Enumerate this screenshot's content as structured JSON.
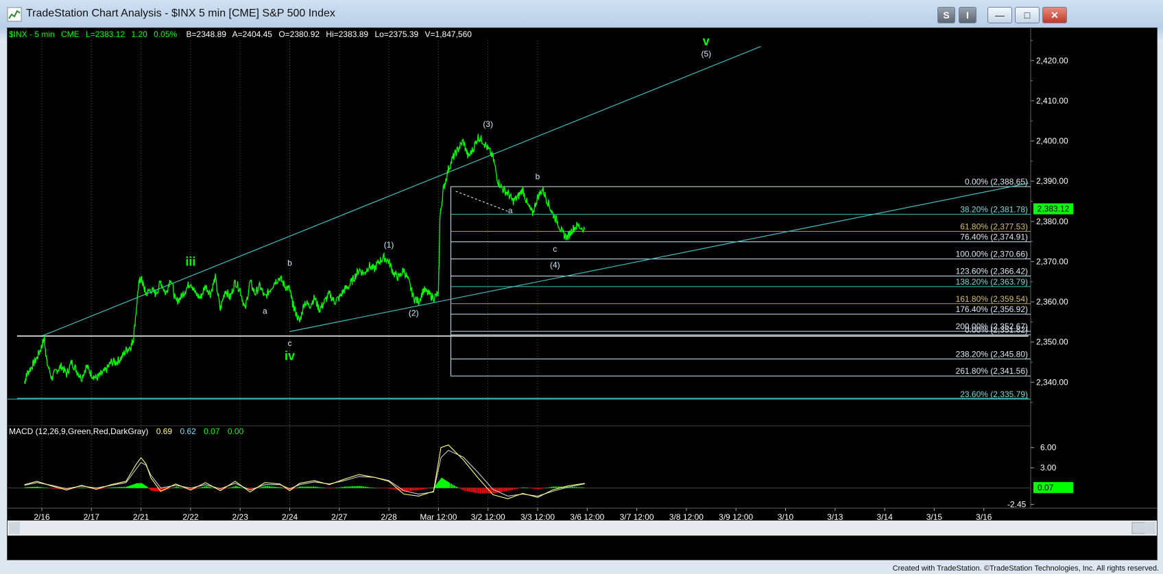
{
  "window": {
    "title": "TradeStation Chart Analysis - $INX 5 min [CME] S&P 500 Index",
    "buttons": {
      "s": "S",
      "i": "I",
      "minimize": "—",
      "maximize": "□",
      "close": "✕"
    }
  },
  "footer": {
    "credit": "Created with TradeStation. ©TradeStation Technologies, Inc. All rights reserved."
  },
  "colors": {
    "price": "#00ff00",
    "trendline": "#3fbfbf",
    "fib_line": "#c8e8f8",
    "fib_gold": "#b8a050",
    "text_green": "#00ff00",
    "wave_label": "#cfe8f8",
    "macd_hist_pos": "#00ff00",
    "macd_hist_neg": "#ff0000",
    "macd_line": "#ffff80",
    "macd_signal": "#d0d0d0"
  },
  "chart_data": {
    "type": "line",
    "header": {
      "symbol": "$INX - 5 min",
      "exchange": "CME",
      "last": "L=2383.12",
      "change": "1.20",
      "pct": "0.05%",
      "b": "B=2348.89",
      "a": "A=2404.45",
      "o": "O=2380.92",
      "hi": "Hi=2383.89",
      "lo": "Lo=2375.39",
      "v": "V=1,847,560"
    },
    "x_labels": [
      {
        "label": "2/16",
        "pos": 0
      },
      {
        "label": "2/17",
        "pos": 1
      },
      {
        "label": "2/21",
        "pos": 2
      },
      {
        "label": "2/22",
        "pos": 3
      },
      {
        "label": "2/23",
        "pos": 4
      },
      {
        "label": "2/24",
        "pos": 5
      },
      {
        "label": "2/27",
        "pos": 6
      },
      {
        "label": "2/28",
        "pos": 7
      },
      {
        "label": "Mar 12:00",
        "pos": 8
      },
      {
        "label": "3/2 12:00",
        "pos": 9
      },
      {
        "label": "3/3 12:00",
        "pos": 10
      },
      {
        "label": "3/6 12:00",
        "pos": 11
      },
      {
        "label": "3/7 12:00",
        "pos": 12
      },
      {
        "label": "3/8 12:00",
        "pos": 13
      },
      {
        "label": "3/9 12:00",
        "pos": 14
      },
      {
        "label": "3/10",
        "pos": 15
      },
      {
        "label": "3/13",
        "pos": 16
      },
      {
        "label": "3/14",
        "pos": 17
      },
      {
        "label": "3/15",
        "pos": 18
      },
      {
        "label": "3/16",
        "pos": 19
      }
    ],
    "ylim": [
      2330,
      2425
    ],
    "y_ticks": [
      "2,340.00",
      "2,350.00",
      "2,360.00",
      "2,370.00",
      "2,380.00",
      "2,390.00",
      "2,400.00",
      "2,410.00",
      "2,420.00"
    ],
    "y_tick_values": [
      2340,
      2350,
      2360,
      2370,
      2380,
      2390,
      2400,
      2410,
      2420
    ],
    "last_price_label": "2,383.12",
    "last_price": 2383.12,
    "price_series": {
      "x": [
        -0.35,
        -0.3,
        -0.2,
        -0.1,
        0.0,
        0.05,
        0.1,
        0.2,
        0.3,
        0.4,
        0.5,
        0.6,
        0.7,
        0.8,
        0.9,
        1.0,
        1.1,
        1.2,
        1.3,
        1.4,
        1.5,
        1.6,
        1.7,
        1.8,
        1.85,
        1.95,
        2.0,
        2.05,
        2.1,
        2.2,
        2.3,
        2.4,
        2.5,
        2.6,
        2.7,
        2.8,
        2.9,
        3.0,
        3.1,
        3.2,
        3.3,
        3.4,
        3.5,
        3.6,
        3.7,
        3.8,
        3.9,
        4.0,
        4.1,
        4.2,
        4.3,
        4.4,
        4.5,
        4.6,
        4.7,
        4.8,
        4.9,
        5.0,
        5.05,
        5.1,
        5.2,
        5.3,
        5.4,
        5.5,
        5.6,
        5.7,
        5.8,
        5.9,
        6.0,
        6.1,
        6.2,
        6.3,
        6.4,
        6.5,
        6.6,
        6.7,
        6.8,
        6.9,
        7.0,
        7.1,
        7.2,
        7.3,
        7.4,
        7.5,
        7.6,
        7.7,
        7.8,
        7.9,
        8.0,
        8.03,
        8.1,
        8.2,
        8.3,
        8.4,
        8.5,
        8.6,
        8.7,
        8.8,
        8.9,
        9.0,
        9.1,
        9.2,
        9.3,
        9.4,
        9.5,
        9.6,
        9.7,
        9.8,
        9.9,
        10.0,
        10.1,
        10.2,
        10.3,
        10.4,
        10.5,
        10.6,
        10.7,
        10.8,
        10.95
      ],
      "y": [
        2340,
        2342,
        2344,
        2346,
        2349,
        2351,
        2345,
        2341,
        2343,
        2344,
        2342,
        2345,
        2343,
        2341,
        2344,
        2342,
        2341,
        2342,
        2343,
        2345,
        2345,
        2346,
        2348,
        2349,
        2351,
        2364,
        2366,
        2364,
        2362,
        2363,
        2362,
        2365,
        2362,
        2366,
        2360,
        2361,
        2363,
        2365,
        2362,
        2361,
        2364,
        2362,
        2366,
        2358,
        2363,
        2361,
        2365,
        2363,
        2358,
        2365,
        2362,
        2364,
        2361,
        2363,
        2365,
        2366,
        2364,
        2363,
        2360,
        2358,
        2355,
        2360,
        2359,
        2361,
        2358,
        2360,
        2362,
        2360,
        2361,
        2363,
        2364,
        2366,
        2368,
        2367,
        2369,
        2368,
        2370,
        2371,
        2370,
        2367,
        2366,
        2368,
        2365,
        2361,
        2360,
        2363,
        2362,
        2361,
        2362,
        2381,
        2388,
        2393,
        2396,
        2398,
        2400,
        2396,
        2398,
        2401,
        2400,
        2398,
        2396,
        2390,
        2388,
        2387,
        2385,
        2386,
        2388,
        2384,
        2382,
        2386,
        2388,
        2385,
        2382,
        2380,
        2377,
        2376,
        2378,
        2379,
        2378
      ]
    },
    "trendlines": [
      {
        "x1": 0.0,
        "y1": 2351.5,
        "x2": 14.5,
        "y2": 2423.5
      },
      {
        "x1": 5.0,
        "y1": 2352.6,
        "x2": 19.9,
        "y2": 2389.5
      },
      {
        "x1": -0.5,
        "y1": 2351.5,
        "x2": 19.9,
        "y2": 2351.5
      },
      {
        "x1": -0.5,
        "y1": 2336.0,
        "x2": 19.9,
        "y2": 2336.0
      }
    ],
    "fib_levels": [
      {
        "label": "0.00% (2,388.65)",
        "value": 2388.65
      },
      {
        "label": "38.20% (2,381.78)",
        "value": 2381.78
      },
      {
        "label": "61.80% (2,377.53)",
        "value": 2377.53
      },
      {
        "label": "76.40% (2,374.91)",
        "value": 2374.91
      },
      {
        "label": "100.00% (2,370.66)",
        "value": 2370.66
      },
      {
        "label": "123.60% (2,366.42)",
        "value": 2366.42
      },
      {
        "label": "138.20% (2,363.79)",
        "value": 2363.79
      },
      {
        "label": "161.80% (2,359.54)",
        "value": 2359.54
      },
      {
        "label": "176.40% (2,356.92)",
        "value": 2356.92
      },
      {
        "label": "200.00% (2,352.67)",
        "value": 2352.67
      },
      {
        "label": "0.00% (2,351.82)",
        "value": 2351.82
      },
      {
        "label": "238.20% (2,345.80)",
        "value": 2345.8
      },
      {
        "label": "261.80% (2,341.56)",
        "value": 2341.56
      },
      {
        "label": "23.60% (2,335.79)",
        "value": 2335.79
      }
    ],
    "fib_x_start": 8.25,
    "wave_labels": [
      {
        "text": "iii",
        "x": 3.0,
        "y": 2369,
        "style": "green-big"
      },
      {
        "text": "a",
        "x": 4.5,
        "y": 2357,
        "style": "small"
      },
      {
        "text": "b",
        "x": 5.0,
        "y": 2369,
        "style": "small"
      },
      {
        "text": "c",
        "x": 5.0,
        "y": 2349,
        "style": "small"
      },
      {
        "text": "iv",
        "x": 5.0,
        "y": 2345.5,
        "style": "green-big"
      },
      {
        "text": "(1)",
        "x": 7.0,
        "y": 2373.5,
        "style": "small"
      },
      {
        "text": "(2)",
        "x": 7.5,
        "y": 2356.5,
        "style": "small"
      },
      {
        "text": "(3)",
        "x": 9.0,
        "y": 2403.5,
        "style": "small"
      },
      {
        "text": "a",
        "x": 9.45,
        "y": 2382,
        "style": "small"
      },
      {
        "text": "b",
        "x": 10.0,
        "y": 2390.5,
        "style": "small"
      },
      {
        "text": "c",
        "x": 10.35,
        "y": 2372.5,
        "style": "small"
      },
      {
        "text": "(4)",
        "x": 10.35,
        "y": 2368.5,
        "style": "small"
      },
      {
        "text": "v",
        "x": 13.4,
        "y": 2423.8,
        "style": "green-big"
      },
      {
        "text": "(5)",
        "x": 13.4,
        "y": 2421,
        "style": "small"
      }
    ],
    "macd": {
      "label": "MACD (12,26,9,Green,Red,DarkGray)",
      "values": [
        "0.69",
        "0.62",
        "0.07",
        "0.00"
      ],
      "value_colors": [
        "#ffff80",
        "#80e0ff",
        "#00ff00",
        "#00ff00"
      ],
      "ylim": [
        -3.2,
        7.5
      ],
      "y_ticks": [
        "6.00",
        "3.00",
        "-2.45"
      ],
      "y_tick_values": [
        6.0,
        3.0,
        -2.45
      ],
      "last_label": "0.07",
      "last_value": 0.07,
      "x": [
        -0.35,
        -0.1,
        0.2,
        0.5,
        0.8,
        1.1,
        1.4,
        1.7,
        1.9,
        2.0,
        2.1,
        2.2,
        2.4,
        2.7,
        3.0,
        3.3,
        3.6,
        3.9,
        4.2,
        4.5,
        4.8,
        5.0,
        5.2,
        5.5,
        5.8,
        6.1,
        6.4,
        6.7,
        7.0,
        7.3,
        7.6,
        7.9,
        8.05,
        8.2,
        8.5,
        8.8,
        9.1,
        9.4,
        9.7,
        10.0,
        10.3,
        10.6,
        10.95
      ],
      "line": [
        0.5,
        1.0,
        0.3,
        -0.3,
        0.4,
        -0.2,
        0.5,
        1.0,
        3.5,
        4.5,
        3.6,
        1.5,
        -0.5,
        0.6,
        -0.3,
        0.8,
        -0.4,
        1.0,
        -0.6,
        0.8,
        0.6,
        -0.4,
        0.7,
        1.1,
        0.5,
        1.3,
        2.0,
        1.6,
        1.0,
        -0.9,
        -1.2,
        -0.5,
        6.0,
        6.4,
        4.2,
        1.5,
        -1.0,
        -1.6,
        -0.8,
        -1.4,
        -0.3,
        0.3,
        0.69
      ],
      "signal": [
        0.4,
        0.8,
        0.4,
        -0.1,
        0.3,
        0.0,
        0.4,
        0.8,
        2.8,
        3.8,
        3.4,
        1.9,
        0.0,
        0.4,
        0.0,
        0.5,
        -0.1,
        0.7,
        -0.3,
        0.5,
        0.5,
        -0.1,
        0.5,
        0.9,
        0.6,
        1.1,
        1.7,
        1.6,
        1.1,
        -0.4,
        -0.9,
        -0.6,
        4.5,
        5.6,
        4.6,
        2.3,
        -0.2,
        -1.2,
        -0.9,
        -1.2,
        -0.5,
        0.1,
        0.62
      ],
      "hist": [
        0.1,
        0.2,
        -0.1,
        -0.2,
        0.1,
        -0.2,
        0.1,
        0.2,
        0.7,
        0.7,
        0.2,
        -0.4,
        -0.5,
        0.2,
        -0.3,
        0.3,
        -0.3,
        0.3,
        -0.3,
        0.3,
        0.1,
        -0.3,
        0.2,
        0.2,
        -0.1,
        0.2,
        0.3,
        0.0,
        -0.1,
        -0.5,
        -0.3,
        0.1,
        1.5,
        0.8,
        -0.4,
        -0.8,
        -0.8,
        -0.4,
        0.1,
        -0.2,
        0.2,
        0.2,
        0.07
      ]
    }
  }
}
